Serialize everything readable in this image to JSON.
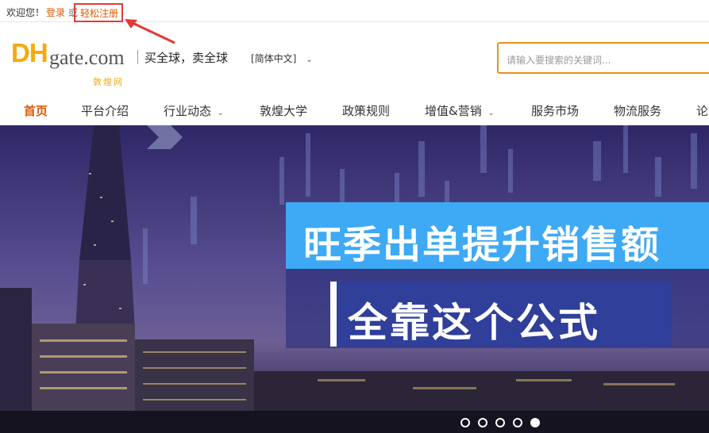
{
  "topbar": {
    "welcome": "欢迎您！",
    "login": "登录",
    "or": "或",
    "register": "轻松注册"
  },
  "header": {
    "logo_dh": "DH",
    "logo_gate": "gate.com",
    "logo_cn": "敦煌网",
    "slogan": "买全球，卖全球",
    "language": "[简体中文]",
    "search_placeholder": "请输入要搜索的关键词..."
  },
  "nav": {
    "items": [
      {
        "label": "首页"
      },
      {
        "label": "平台介绍"
      },
      {
        "label": "行业动态"
      },
      {
        "label": "敦煌大学"
      },
      {
        "label": "政策规则"
      },
      {
        "label": "增值&营销"
      },
      {
        "label": "服务市场"
      },
      {
        "label": "物流服务"
      },
      {
        "label": "论"
      }
    ]
  },
  "banner": {
    "headline1": "旺季出单提升销售额",
    "headline2": "全靠这个公式",
    "slides": 5,
    "active_slide": 5
  },
  "colors": {
    "accent": "#e05a00",
    "brand_yellow": "#f7a90a",
    "headline_blue": "#3ea9f5",
    "headline_navy": "#2f3f9a",
    "annotation_red": "#e53935"
  }
}
